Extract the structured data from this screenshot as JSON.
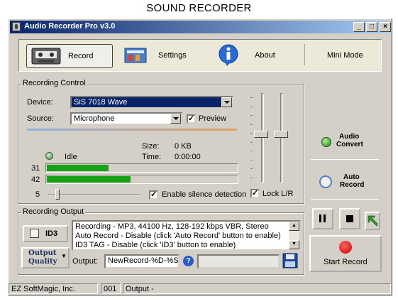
{
  "page_caption": "SOUND RECORDER",
  "window": {
    "title": "Audio Recorder Pro v3.0",
    "min": "_",
    "max": "□",
    "close": "×"
  },
  "toolbar": {
    "record": "Record",
    "settings": "Settings",
    "about": "About",
    "mini_mode": "Mini Mode"
  },
  "recording_control": {
    "legend": "Recording Control",
    "device_label": "Device:",
    "device_value": "SiS 7018 Wave",
    "source_label": "Source:",
    "source_value": "Microphone",
    "preview_label": "Preview",
    "preview_checked": true,
    "status": "Idle",
    "size_label": "Size:",
    "size_value": "0 KB",
    "time_label": "Time:",
    "time_value": "0:00:00",
    "meter_left_value": "31",
    "meter_right_value": "42",
    "meter_left_level": 0.31,
    "meter_right_level": 0.42,
    "silence_level": "5",
    "silence_label": "Enable silence detection",
    "silence_checked": true,
    "lock_label": "Lock L/R",
    "lock_checked": true
  },
  "side_buttons": {
    "audio_convert_line1": "Audio",
    "audio_convert_line2": "Convert",
    "auto_record_line1": "Auto",
    "auto_record_line2": "Record"
  },
  "recording_output": {
    "legend": "Recording Output",
    "id3_label": "ID3",
    "quality_line1": "Output",
    "quality_line2": "Quality",
    "info_lines": [
      "Recording - MP3, 44100 Hz, 128-192 kbps VBR, Stereo",
      "Auto Record - Disable (click 'Auto Record' button to enable)",
      "ID3 TAG - Disable (click 'ID3' button to enable)"
    ],
    "output_label": "Output:",
    "output_value": "NewRecord-%D-%S",
    "help_glyph": "?"
  },
  "transport": {
    "start_record": "Start Record"
  },
  "status_bar": {
    "company": "EZ SoftMagic, Inc.",
    "code": "001",
    "output": "Output -"
  }
}
